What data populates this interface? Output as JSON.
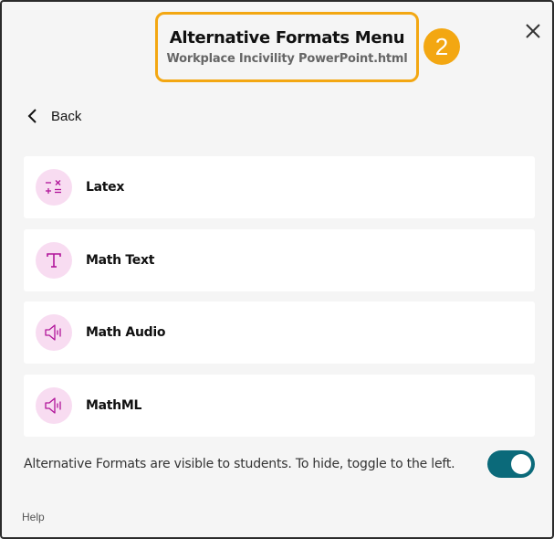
{
  "header": {
    "title": "Alternative Formats Menu",
    "subtitle": "Workplace Incivility PowerPoint.html",
    "step_number": "2",
    "highlight_color": "#f3a712"
  },
  "nav": {
    "back_label": "Back"
  },
  "formats": [
    {
      "label": "Latex",
      "icon": "math-operators-icon"
    },
    {
      "label": "Math Text",
      "icon": "text-t-icon"
    },
    {
      "label": "Math Audio",
      "icon": "speaker-icon"
    },
    {
      "label": "MathML",
      "icon": "speaker-icon"
    }
  ],
  "visibility": {
    "message": "Alternative Formats are visible to students. To hide, toggle to the left.",
    "enabled": true,
    "toggle_color": "#0b6a7a"
  },
  "footer": {
    "help_label": "Help"
  },
  "colors": {
    "icon_bg": "#f8dcf1",
    "icon_fg": "#b1159a"
  }
}
